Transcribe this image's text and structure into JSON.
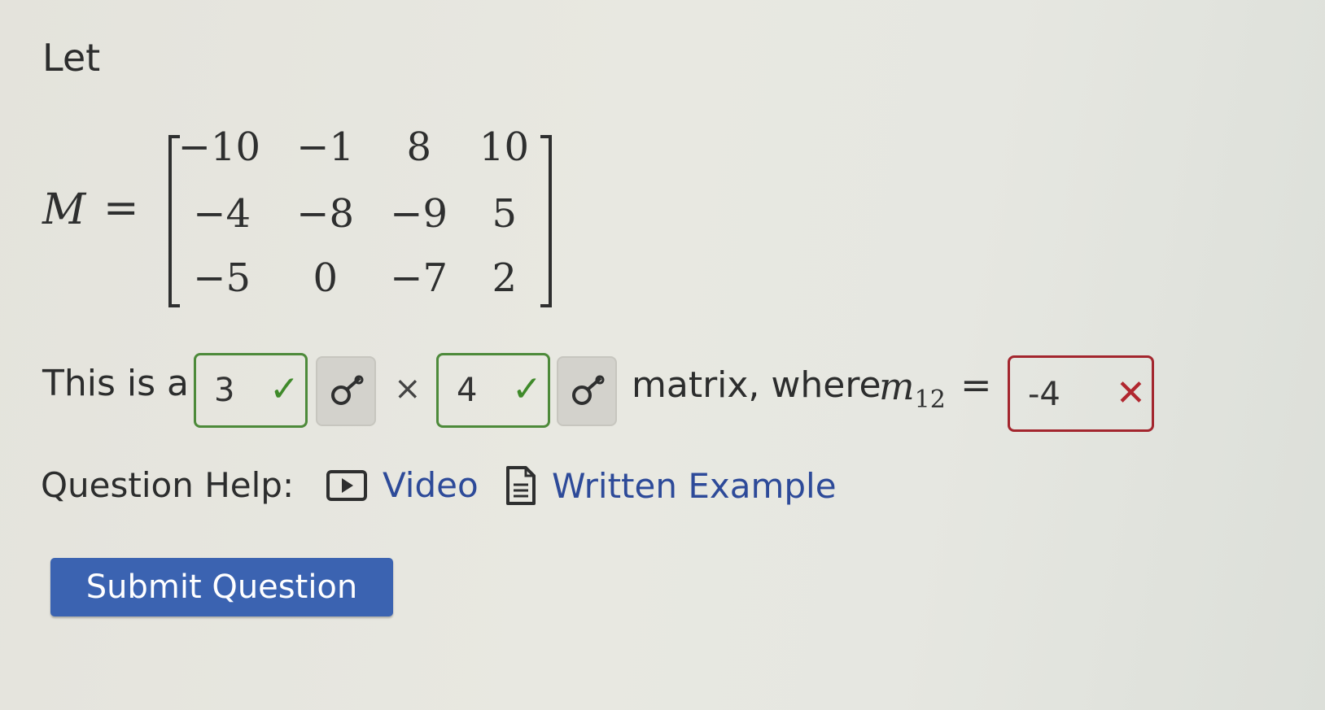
{
  "intro": "Let",
  "matrix": {
    "name": "M",
    "equals": "=",
    "rows": [
      [
        "−10",
        "−1",
        "8",
        "10"
      ],
      [
        "−4",
        "−8",
        "−9",
        "5"
      ],
      [
        "−5",
        "0",
        "−7",
        "2"
      ]
    ]
  },
  "sentence": {
    "prefix": "This is a",
    "rows_answer": "3",
    "rows_status": "correct",
    "times": "×",
    "cols_answer": "4",
    "cols_status": "correct",
    "middle": "matrix, where",
    "entry_symbol": "m",
    "entry_subscript": "12",
    "equals": "=",
    "entry_answer": "-4",
    "entry_status": "incorrect"
  },
  "marks": {
    "check": "✓",
    "cross": "✕"
  },
  "help": {
    "label": "Question Help:",
    "video": "Video",
    "written": "Written Example"
  },
  "submit_label": "Submit Question",
  "colors": {
    "correct": "#3f8a2a",
    "incorrect": "#b1272f",
    "link": "#2d4a99",
    "button": "#3b63b1"
  },
  "icons": [
    "key-icon",
    "video-icon",
    "document-icon",
    "check-icon",
    "cross-icon"
  ]
}
